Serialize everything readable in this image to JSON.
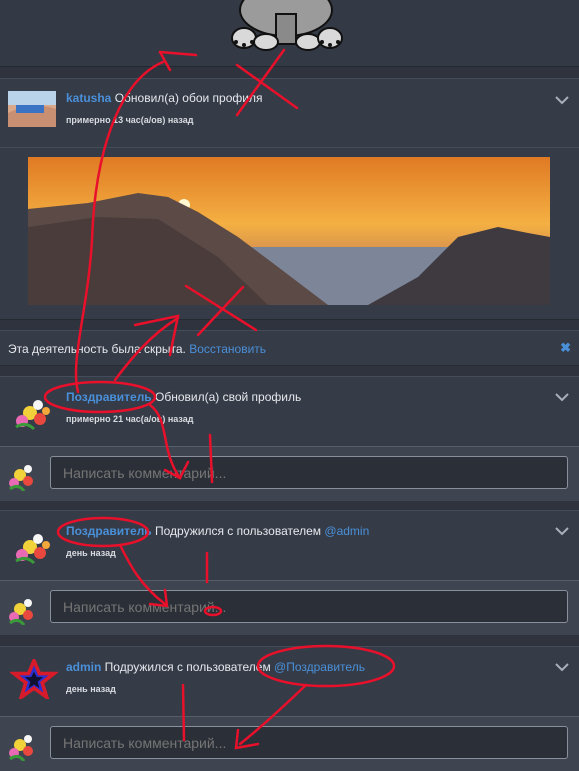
{
  "feed": {
    "item1": {
      "user": "katusha",
      "action": " Обновил(а) обои профиля",
      "time": "примерно 13 час(а/ов) назад"
    },
    "hidden": {
      "text": "Эта деятельность была скрыта. ",
      "restore": "Восстановить",
      "close": "✖"
    },
    "item2": {
      "user": "Поздравитель",
      "action": " Обновил(а) свой профиль",
      "time": "примерно 21 час(а/ов) назад"
    },
    "item3": {
      "user": "Поздравитель",
      "action": " Подружился с пользователем ",
      "mention": "@admin",
      "time": "день назад"
    },
    "item4": {
      "user": "admin",
      "action": " Подружился с пользователем ",
      "mention": "@Поздравитель",
      "time": "день назад"
    }
  },
  "comment": {
    "placeholder": "Написать комментарий..."
  },
  "colors": {
    "accent": "#4a90d9",
    "annotation": "#e8102a",
    "card": "#353b47"
  }
}
